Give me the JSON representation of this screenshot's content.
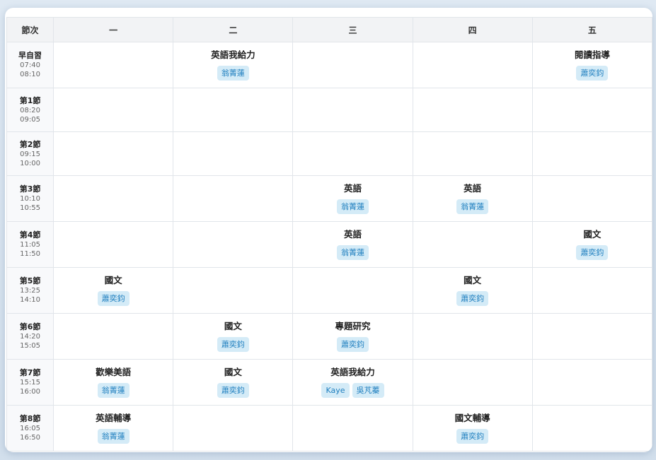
{
  "header": {
    "period_col": "節次",
    "days": [
      "一",
      "二",
      "三",
      "四",
      "五"
    ]
  },
  "rows": [
    {
      "name": "早自習",
      "start": "07:40",
      "end": "08:10",
      "cells": [
        null,
        {
          "subject": "英語我給力",
          "teachers": [
            "翁菁蓮"
          ]
        },
        null,
        null,
        {
          "subject": "閱讀指導",
          "teachers": [
            "蕭奕鈞"
          ]
        }
      ]
    },
    {
      "name": "第1節",
      "start": "08:20",
      "end": "09:05",
      "cells": [
        null,
        null,
        null,
        null,
        null
      ]
    },
    {
      "name": "第2節",
      "start": "09:15",
      "end": "10:00",
      "cells": [
        null,
        null,
        null,
        null,
        null
      ]
    },
    {
      "name": "第3節",
      "start": "10:10",
      "end": "10:55",
      "cells": [
        null,
        null,
        {
          "subject": "英語",
          "teachers": [
            "翁菁蓮"
          ]
        },
        {
          "subject": "英語",
          "teachers": [
            "翁菁蓮"
          ]
        },
        null
      ]
    },
    {
      "name": "第4節",
      "start": "11:05",
      "end": "11:50",
      "cells": [
        null,
        null,
        {
          "subject": "英語",
          "teachers": [
            "翁菁蓮"
          ]
        },
        null,
        {
          "subject": "國文",
          "teachers": [
            "蕭奕鈞"
          ]
        }
      ]
    },
    {
      "name": "第5節",
      "start": "13:25",
      "end": "14:10",
      "cells": [
        {
          "subject": "國文",
          "teachers": [
            "蕭奕鈞"
          ]
        },
        null,
        null,
        {
          "subject": "國文",
          "teachers": [
            "蕭奕鈞"
          ]
        },
        null
      ]
    },
    {
      "name": "第6節",
      "start": "14:20",
      "end": "15:05",
      "cells": [
        null,
        {
          "subject": "國文",
          "teachers": [
            "蕭奕鈞"
          ]
        },
        {
          "subject": "專題研究",
          "teachers": [
            "蕭奕鈞"
          ]
        },
        null,
        null
      ]
    },
    {
      "name": "第7節",
      "start": "15:15",
      "end": "16:00",
      "cells": [
        {
          "subject": "歡樂美語",
          "teachers": [
            "翁菁蓮"
          ]
        },
        {
          "subject": "國文",
          "teachers": [
            "蕭奕鈞"
          ]
        },
        {
          "subject": "英語我給力",
          "teachers": [
            "Kaye",
            "吳芃蓁"
          ]
        },
        null,
        null
      ]
    },
    {
      "name": "第8節",
      "start": "16:05",
      "end": "16:50",
      "cells": [
        {
          "subject": "英語輔導",
          "teachers": [
            "翁菁蓮"
          ]
        },
        null,
        null,
        {
          "subject": "國文輔導",
          "teachers": [
            "蕭奕鈞"
          ]
        },
        null
      ]
    }
  ]
}
